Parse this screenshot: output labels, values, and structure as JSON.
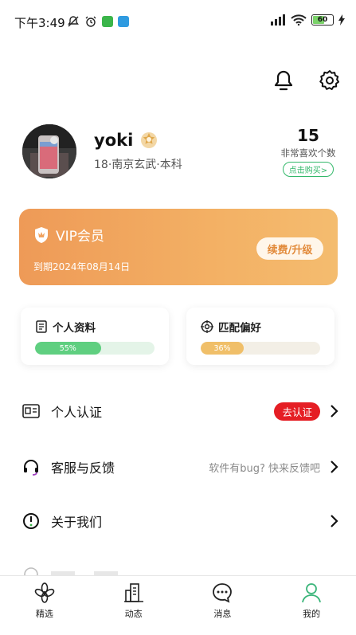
{
  "status_bar": {
    "time": "下午3:49",
    "battery": "60",
    "network": "HD"
  },
  "profile": {
    "name": "yoki",
    "meta": "18·南京玄武·本科",
    "likes_count": "15",
    "likes_label": "非常喜欢个数",
    "buy_label": "点击购买>"
  },
  "vip": {
    "title": "VIP会员",
    "expiry": "到期2024年08月14日",
    "renew_label": "续费/升级"
  },
  "stats": [
    {
      "title": "个人资料",
      "percent_label": "55%",
      "value": 0.55,
      "color": "#5fcf80",
      "track": "#e4f4e8"
    },
    {
      "title": "匹配偏好",
      "percent_label": "36%",
      "value": 0.36,
      "color": "#f0bf69",
      "track": "#f3efe6"
    }
  ],
  "menu": {
    "verify": {
      "label": "个人认证",
      "badge": "去认证"
    },
    "support": {
      "label": "客服与反馈",
      "hint": "软件有bug? 快来反馈吧"
    },
    "about": {
      "label": "关于我们"
    }
  },
  "tabs": [
    {
      "label": "精选",
      "icon": "flower-icon"
    },
    {
      "label": "动态",
      "icon": "building-icon"
    },
    {
      "label": "消息",
      "icon": "chat-icon"
    },
    {
      "label": "我的",
      "icon": "person-icon",
      "active": true
    }
  ],
  "colors": {
    "accent_green": "#33b86a",
    "vip_orange": "#ee9a57",
    "badge_red": "#e51e24"
  }
}
